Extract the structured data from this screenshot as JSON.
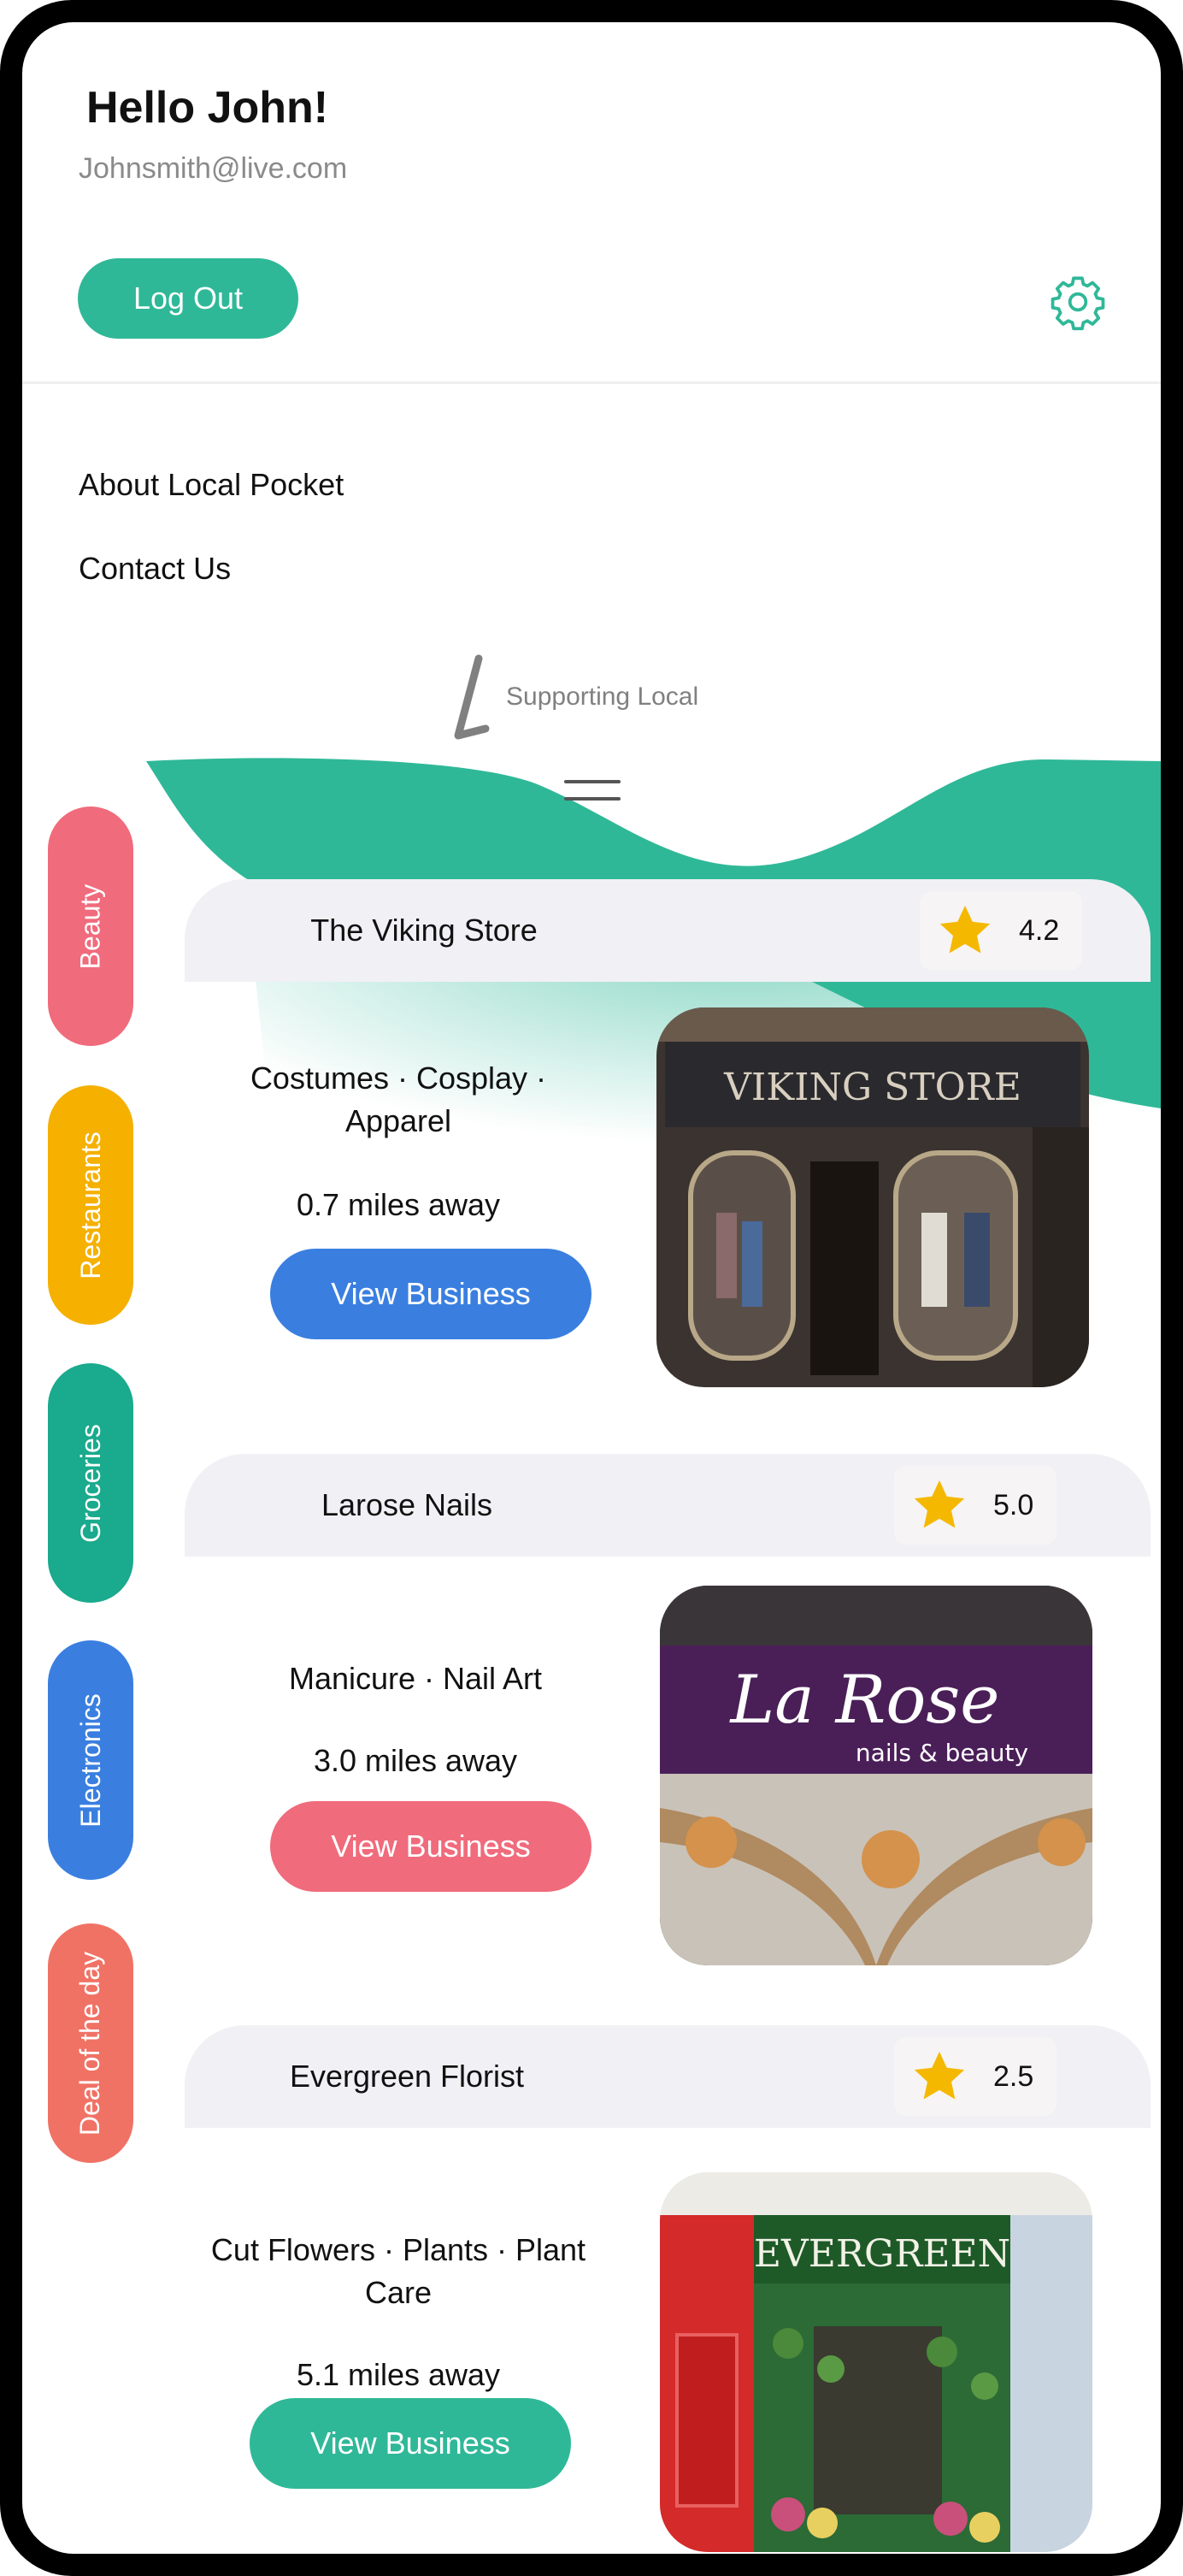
{
  "header": {
    "greeting": "Hello John!",
    "email": "Johnsmith@live.com",
    "logout_label": "Log Out",
    "settings_icon": "gear-icon"
  },
  "menu": {
    "about": "About Local Pocket",
    "contact": "Contact Us"
  },
  "brand": {
    "tagline": "Supporting Local"
  },
  "categories": [
    {
      "label": "Beauty",
      "color": "#f06b7c"
    },
    {
      "label": "Restaurants",
      "color": "#f5b000"
    },
    {
      "label": "Groceries",
      "color": "#1aaa8d"
    },
    {
      "label": "Electronics",
      "color": "#3a7fe0"
    },
    {
      "label": "Deal of the day",
      "color": "#f07265"
    }
  ],
  "businesses": [
    {
      "name": "The Viking Store",
      "rating": "4.2",
      "tags_line1": "Costumes · Cosplay ·",
      "tags_line2": "Apparel",
      "distance": "0.7 miles away",
      "button_label": "View Business",
      "button_color": "#3a7fe0",
      "sign_text": "VIKING STORE"
    },
    {
      "name": "Larose Nails",
      "rating": "5.0",
      "tags_line1": "Manicure · Nail Art",
      "tags_line2": "",
      "distance": "3.0 miles away",
      "button_label": "View Business",
      "button_color": "#f06b7c",
      "sign_text": "La Rose",
      "sign_sub": "nails & beauty"
    },
    {
      "name": "Evergreen Florist",
      "rating": "2.5",
      "tags_line1": "Cut Flowers · Plants · Plant",
      "tags_line2": "Care",
      "distance": "5.1 miles away",
      "button_label": "View Business",
      "button_color": "#2fb898",
      "sign_text": "EVERGREEN"
    }
  ],
  "colors": {
    "accent": "#2fb898",
    "star": "#f5b800"
  }
}
